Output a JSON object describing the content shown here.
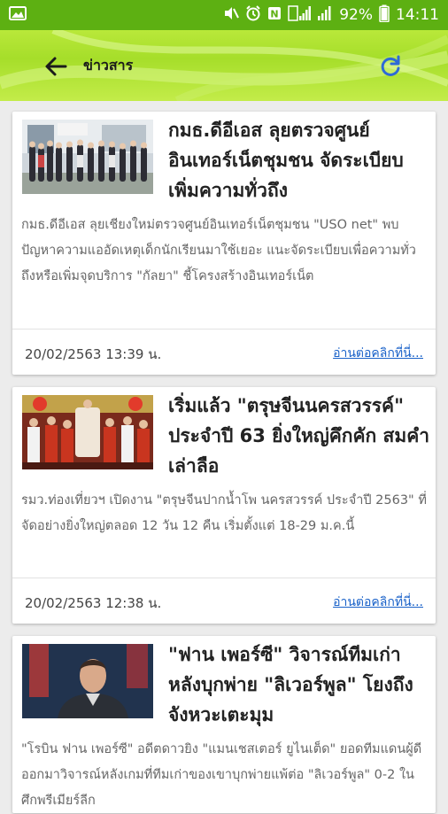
{
  "status_bar": {
    "battery": "92%",
    "time": "14:11",
    "icons": [
      "image-icon",
      "mute-icon",
      "alarm-icon",
      "nfc-icon",
      "signal-icon",
      "wifi-signal-icon",
      "battery-icon"
    ]
  },
  "app_bar": {
    "title": "ข่าวสาร",
    "back_icon": "arrow-left-icon",
    "refresh_icon": "refresh-icon"
  },
  "theme": {
    "status_bar_color": "#5db012",
    "app_bar_color": "#b2e335",
    "link_color": "#1a62c9",
    "refresh_icon_color": "#2e6ad6"
  },
  "articles": [
    {
      "title": "กมธ.ดีอีเอส ลุยตรวจศูนย์อินเทอร์เน็ตชุมชน จัดระเบียบเพิ่มความทั่วถึง",
      "summary": "กมธ.ดีอีเอส ลุยเชียงใหม่ตรวจศูนย์อินเทอร์เน็ตชุมชน \"USO net\" พบปัญหาความแออัดเหตุเด็กนักเรียนมาใช้เยอะ แนะจัดระเบียบเพื่อความทั่วถึงหรือเพิ่มจุดบริการ \"กัลยา\" ชี้โครงสร้างอินเทอร์เน็ต",
      "date": "20/02/2563 13:39 น.",
      "read_more": "อ่านต่อคลิกที่นี่..."
    },
    {
      "title": "เริ่มแล้ว \"ตรุษจีนนครสวรรค์\" ประจำปี 63 ยิ่งใหญ่คึกคัก สมคำเล่าลือ",
      "summary": "รมว.ท่องเที่ยวฯ เปิดงาน \"ตรุษจีนปากน้ำโพ นครสวรรค์ ประจำปี 2563\" ที่จัดอย่างยิ่งใหญ่ตลอด 12 วัน 12 คืน เริ่มตั้งแต่ 18-29 ม.ค.นี้",
      "date": "20/02/2563 12:38 น.",
      "read_more": "อ่านต่อคลิกที่นี่..."
    },
    {
      "title": "\"ฟาน เพอร์ซี\" วิจารณ์ทีมเก่าหลังบุกพ่าย \"ลิเวอร์พูล\" โยงถึงจังหวะเตะมุม",
      "summary": "\"โรบิน ฟาน เพอร์ซี\" อดีตดาวยิง \"แมนเชสเตอร์ ยูไนเต็ด\" ยอดทีมแดนผู้ดี ออกมาวิจารณ์หลังเกมที่ทีมเก่าของเขาบุกพ่ายแพ้ต่อ \"ลิเวอร์พูล\" 0-2 ในศึกพรีเมียร์ลีก"
    }
  ]
}
